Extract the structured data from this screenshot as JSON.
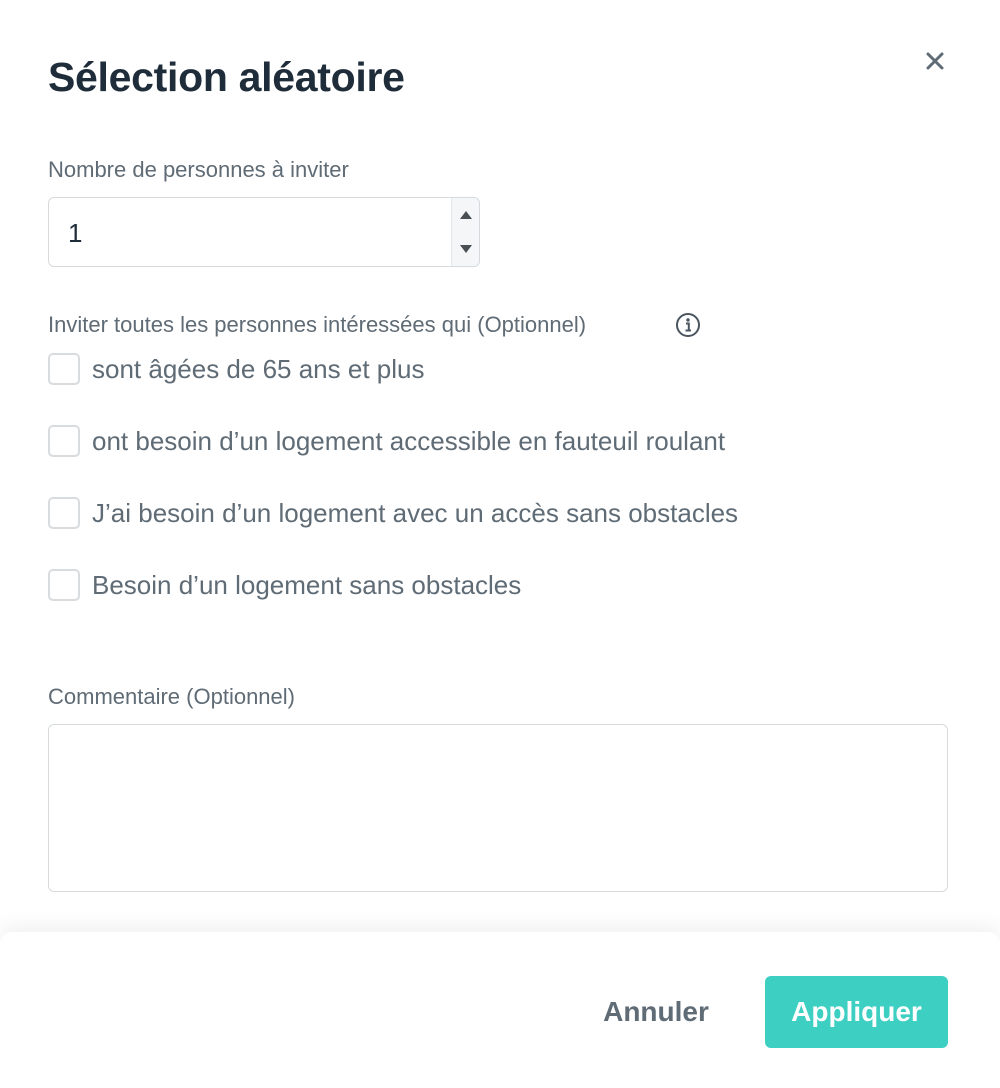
{
  "modal": {
    "title": "Sélection aléatoire",
    "close_icon": "close-icon"
  },
  "invite_count": {
    "label": "Nombre de personnes à inviter",
    "value": "1",
    "stepper_icons": [
      "caret-up-icon",
      "caret-down-icon"
    ]
  },
  "criteria": {
    "label": "Inviter toutes les personnes intéressées qui (Optionnel)",
    "info_icon": "info-circle-icon",
    "options": [
      {
        "label": "sont âgées de 65 ans et plus",
        "checked": false
      },
      {
        "label": "ont besoin d’un logement accessible en fauteuil roulant",
        "checked": false
      },
      {
        "label": "J’ai besoin d’un logement avec un accès sans obstacles",
        "checked": false
      },
      {
        "label": "Besoin d’un logement sans obstacles",
        "checked": false
      }
    ]
  },
  "comment": {
    "label": "Commentaire (Optionnel)",
    "value": ""
  },
  "footer": {
    "cancel_label": "Annuler",
    "apply_label": "Appliquer"
  },
  "colors": {
    "accent": "#3ccfc2",
    "title_text": "#1f2d3a",
    "muted_text": "#5f6b75",
    "border": "#d6dadd"
  }
}
